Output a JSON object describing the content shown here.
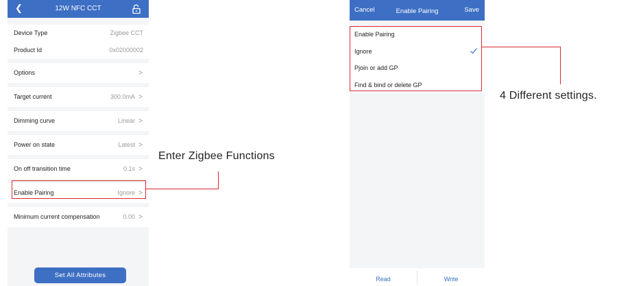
{
  "left_screen": {
    "title": "12W NFC CCT",
    "icons": {
      "back": "chevron-left-icon",
      "lock": "unlock-icon"
    },
    "rows": [
      {
        "label": "Device Type",
        "value": "Zigbee CCT",
        "chevron": false
      },
      {
        "label": "Product Id",
        "value": "0x02000002",
        "chevron": false
      },
      {
        "label": "Options",
        "value": "",
        "chevron": true
      },
      {
        "label": "Target current",
        "value": "300.0mA",
        "chevron": true
      },
      {
        "label": "Dimming curve",
        "value": "Linear",
        "chevron": true
      },
      {
        "label": "Power on state",
        "value": "Latest",
        "chevron": true
      },
      {
        "label": "On off transition time",
        "value": "0.1s",
        "chevron": true
      },
      {
        "label": "Enable Pairing",
        "value": "Ignore",
        "chevron": true
      },
      {
        "label": "Minimum current compensation",
        "value": "0.00",
        "chevron": true
      }
    ],
    "chevron_glyph": ">",
    "set_all_button": "Set All Attributes"
  },
  "right_screen": {
    "cancel": "Cancel",
    "title": "Enable Pairing",
    "save": "Save",
    "options": [
      {
        "label": "Enable Pairing",
        "selected": false
      },
      {
        "label": "Ignore",
        "selected": true
      },
      {
        "label": "Pjoin or add GP",
        "selected": false
      },
      {
        "label": "Find & bind or delete GP",
        "selected": false
      }
    ],
    "read": "Read",
    "write": "Write"
  },
  "annotations": {
    "left": "Enter Zigbee Functions",
    "right": "4 Different settings."
  },
  "colors": {
    "brand_blue": "#3d6fc4",
    "highlight_red": "#d9282f"
  }
}
